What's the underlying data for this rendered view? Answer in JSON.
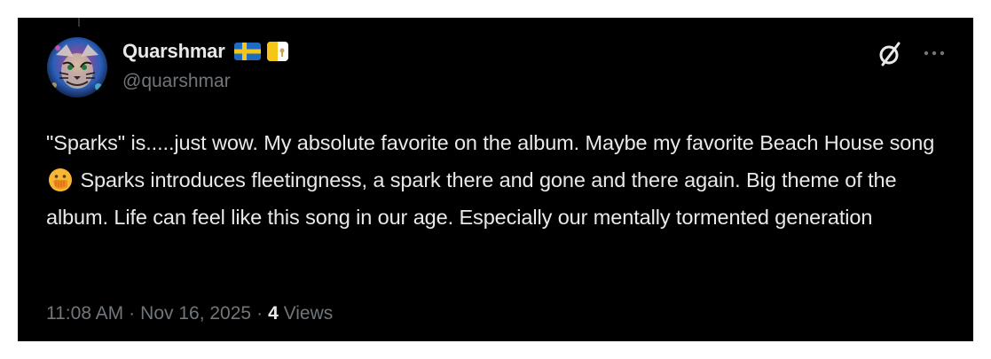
{
  "author": {
    "display_name": "Quarshmar",
    "handle": "@quarshmar",
    "flag_icon": "sweden-flag-icon",
    "badge_icon": "vatican-flag-icon"
  },
  "actions": {
    "grok_icon": "grok-slash-icon",
    "more_icon": "more-dots-icon"
  },
  "tweet": {
    "text_part1": "\"Sparks\" is.....just wow. My absolute favorite on the album. Maybe my favorite Beach House song",
    "emoji": "face-with-hand-over-mouth-emoji",
    "text_part2": "Sparks introduces fleetingness, a spark there and gone and there again. Big theme of the album. Life can feel like this song in our age. Especially our mentally tormented generation"
  },
  "meta": {
    "time": "11:08 AM",
    "separator": "·",
    "date": "Nov 16, 2025",
    "views_count": "4",
    "views_label": "Views"
  },
  "colors": {
    "background": "#000000",
    "text_primary": "#e7e9ea",
    "text_secondary": "#71767b"
  }
}
